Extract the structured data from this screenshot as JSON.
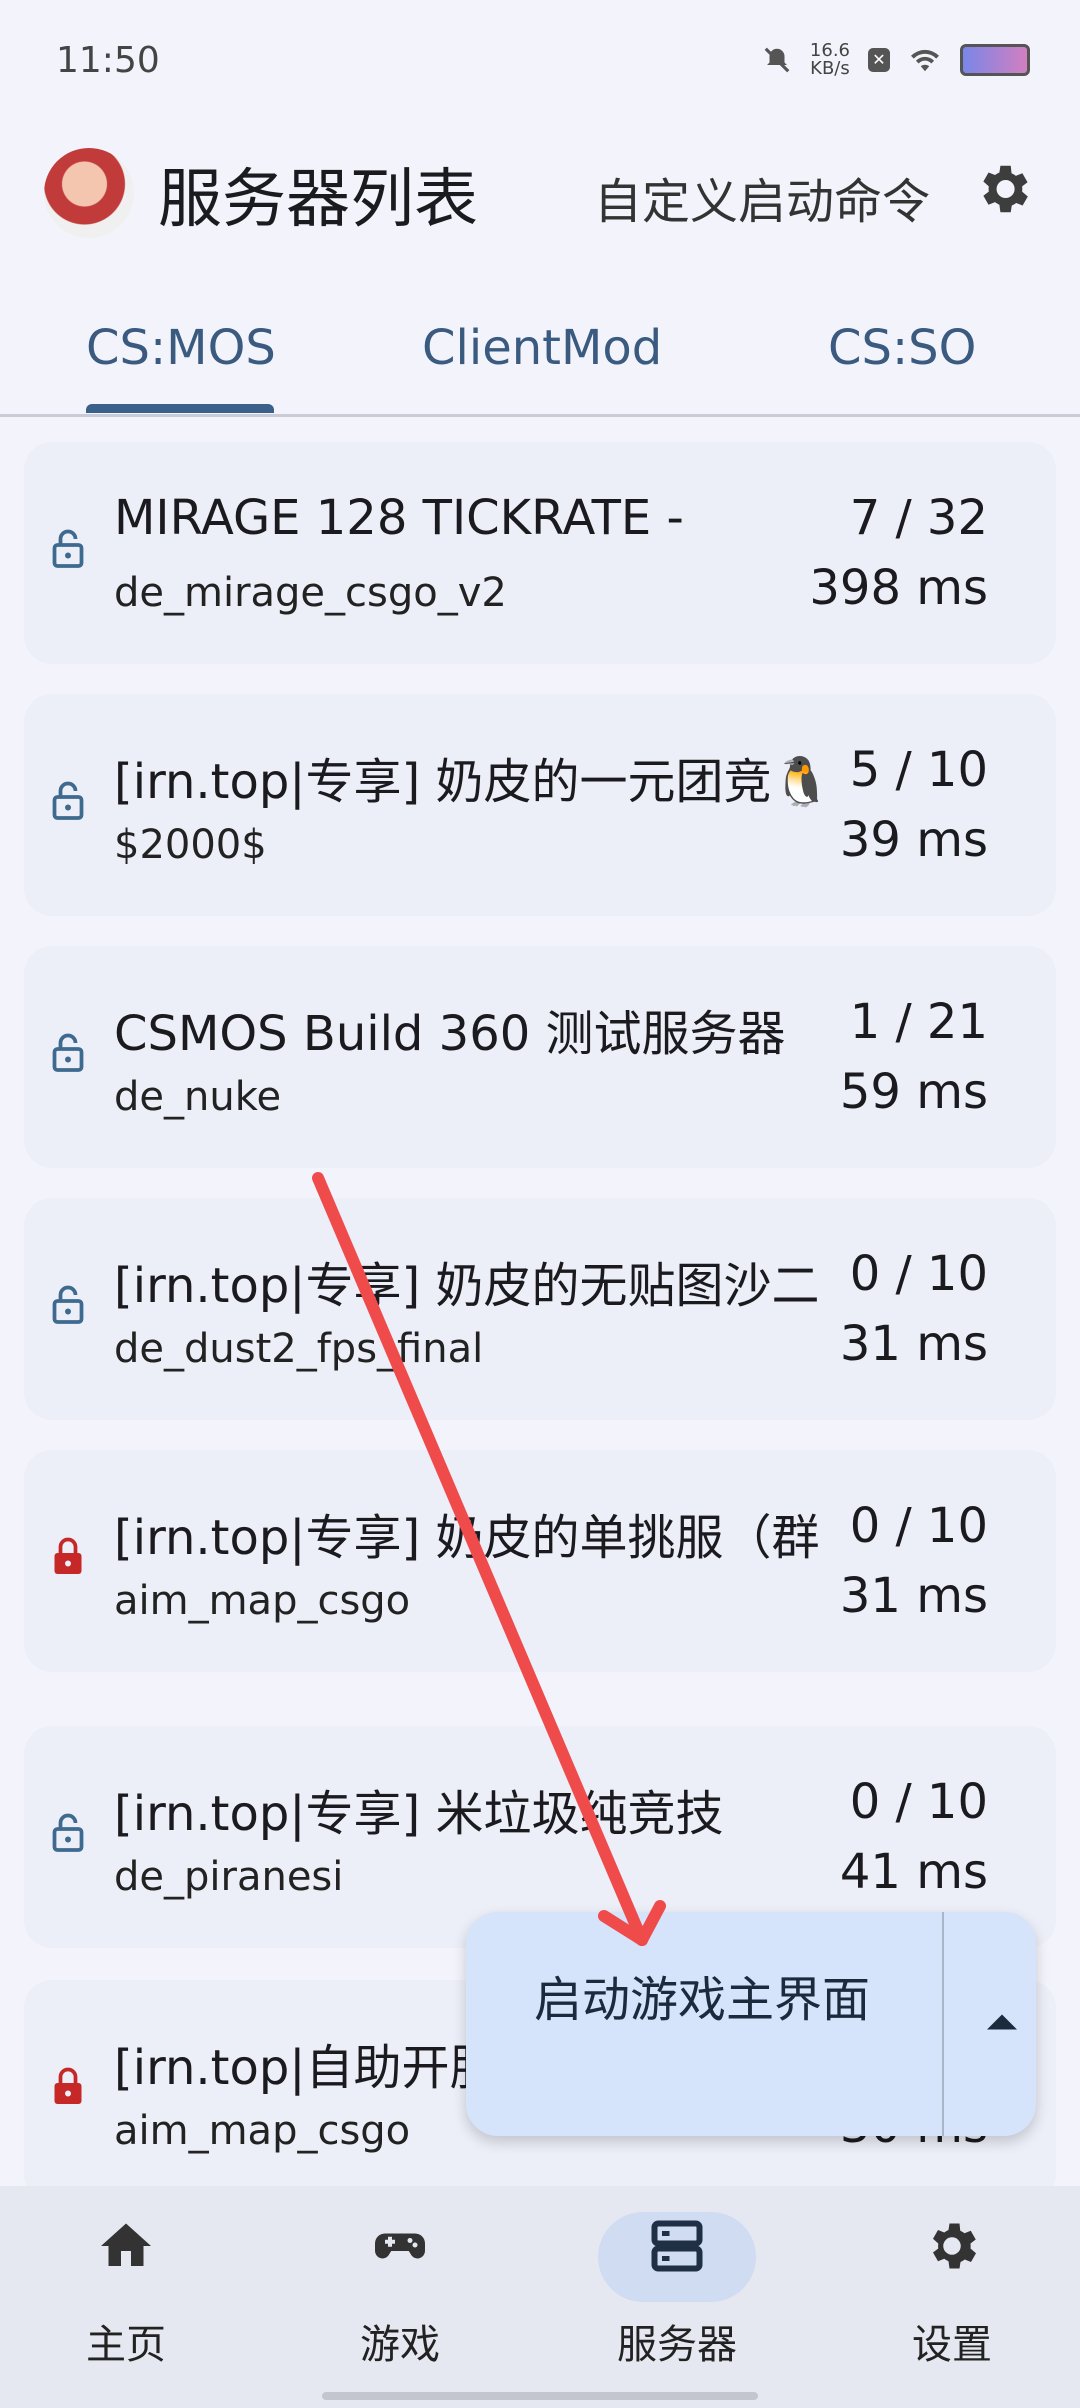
{
  "status_bar": {
    "time": "11:50",
    "net_speed": "16.6",
    "net_unit": "KB/s"
  },
  "header": {
    "title": "服务器列表",
    "custom_command": "自定义启动命令"
  },
  "tabs": [
    {
      "label": "CS:MOS",
      "selected": true
    },
    {
      "label": "ClientMod",
      "selected": false
    },
    {
      "label": "CS:SO",
      "selected": false
    }
  ],
  "servers": [
    {
      "name": "MIRAGE 128 TICKRATE -",
      "map": "de_mirage_csgo_v2",
      "players": "7 / 32",
      "ping": "398 ms",
      "locked": false
    },
    {
      "name": "[irn.top|专享] 奶皮的一元团竞🐧",
      "map": "$2000$",
      "players": "5 / 10",
      "ping": "39 ms",
      "locked": false
    },
    {
      "name": "CSMOS Build 360 测试服务器",
      "map": "de_nuke",
      "players": "1 / 21",
      "ping": "59 ms",
      "locked": false
    },
    {
      "name": "[irn.top|专享] 奶皮的无贴图沙二",
      "map": "de_dust2_fps_final",
      "players": "0 / 10",
      "ping": "31 ms",
      "locked": false
    },
    {
      "name": "[irn.top|专享] 奶皮的单挑服（群",
      "map": "aim_map_csgo",
      "players": "0 / 10",
      "ping": "31 ms",
      "locked": true
    },
    {
      "name": "[irn.top|专享] 米垃圾纯竞技",
      "map": "de_piranesi",
      "players": "0 / 10",
      "ping": "41 ms",
      "locked": false
    },
    {
      "name": "[irn.top|自助开服",
      "map": "aim_map_csgo",
      "players": "",
      "ping": "30 ms",
      "locked": true
    }
  ],
  "fab": {
    "label": "启动游戏主界面"
  },
  "bottom_nav": [
    {
      "label": "主页",
      "icon": "home-icon",
      "selected": false
    },
    {
      "label": "游戏",
      "icon": "gamepad-icon",
      "selected": false
    },
    {
      "label": "服务器",
      "icon": "server-icon",
      "selected": true
    },
    {
      "label": "设置",
      "icon": "gear-icon",
      "selected": false
    }
  ],
  "colors": {
    "accent": "#3a5f88",
    "lock_open": "#3e6a8f",
    "lock_closed": "#c62828",
    "annotation": "#ef4b4b"
  }
}
